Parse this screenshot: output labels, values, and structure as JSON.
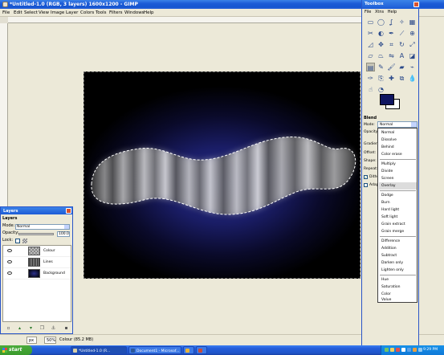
{
  "main_window": {
    "title": "*Untitled-1.0 (RGB, 3 layers) 1600x1200 - GIMP",
    "menu": [
      "File",
      "Edit",
      "Select",
      "View",
      "Image",
      "Layer",
      "Colors",
      "Tools",
      "Filters",
      "Windows",
      "Help"
    ]
  },
  "statusbar": {
    "unit": "px",
    "zoom": "50%",
    "info": "Colour (85.2 MB)"
  },
  "layers_dialog": {
    "title": "Layers",
    "header": "Layers",
    "mode_label": "Mode:",
    "mode_value": "Normal",
    "opacity_label": "Opacity:",
    "opacity_value": "100.0",
    "lock_label": "Lock:",
    "layers": [
      {
        "name": "Colour",
        "thumb": "#7a7a7a"
      },
      {
        "name": "Lines",
        "thumb": "#3a3a3a"
      },
      {
        "name": "Background",
        "thumb": "#12145a"
      }
    ]
  },
  "toolbox": {
    "title": "Toolbox",
    "menu": [
      "File",
      "Xtns",
      "Help"
    ],
    "fg_color": "#0f1560",
    "bg_color": "#ffffff",
    "options_title": "Blend",
    "mode_label": "Mode:",
    "mode_value": "Normal",
    "opacity_label": "Opacity:",
    "gradient_label": "Gradient:",
    "offset_label": "Offset:",
    "shape_label": "Shape:",
    "repeat_label": "Repeat:",
    "dither_label": "Dithe",
    "adaptive_label": "Adap"
  },
  "blend_modes": {
    "highlighted": "Overlay",
    "groups": [
      [
        "Normal",
        "Dissolve",
        "Behind",
        "Color erase"
      ],
      [
        "Multiply",
        "Divide",
        "Screen",
        "Overlay"
      ],
      [
        "Dodge",
        "Burn",
        "Hard light",
        "Soft light",
        "Grain extract",
        "Grain merge"
      ],
      [
        "Difference",
        "Addition",
        "Subtract",
        "Darken only",
        "Lighten only"
      ],
      [
        "Hue",
        "Saturation",
        "Color",
        "Value"
      ]
    ]
  },
  "taskbar": {
    "start_label": "start",
    "tasks": [
      {
        "label": "*Untitled-1.0 (R...",
        "active": true
      },
      {
        "label": "Document1 - Microsof...",
        "active": false
      },
      {
        "label": "",
        "active": false
      },
      {
        "label": "",
        "active": false
      }
    ],
    "clock": "9:29 PM"
  }
}
